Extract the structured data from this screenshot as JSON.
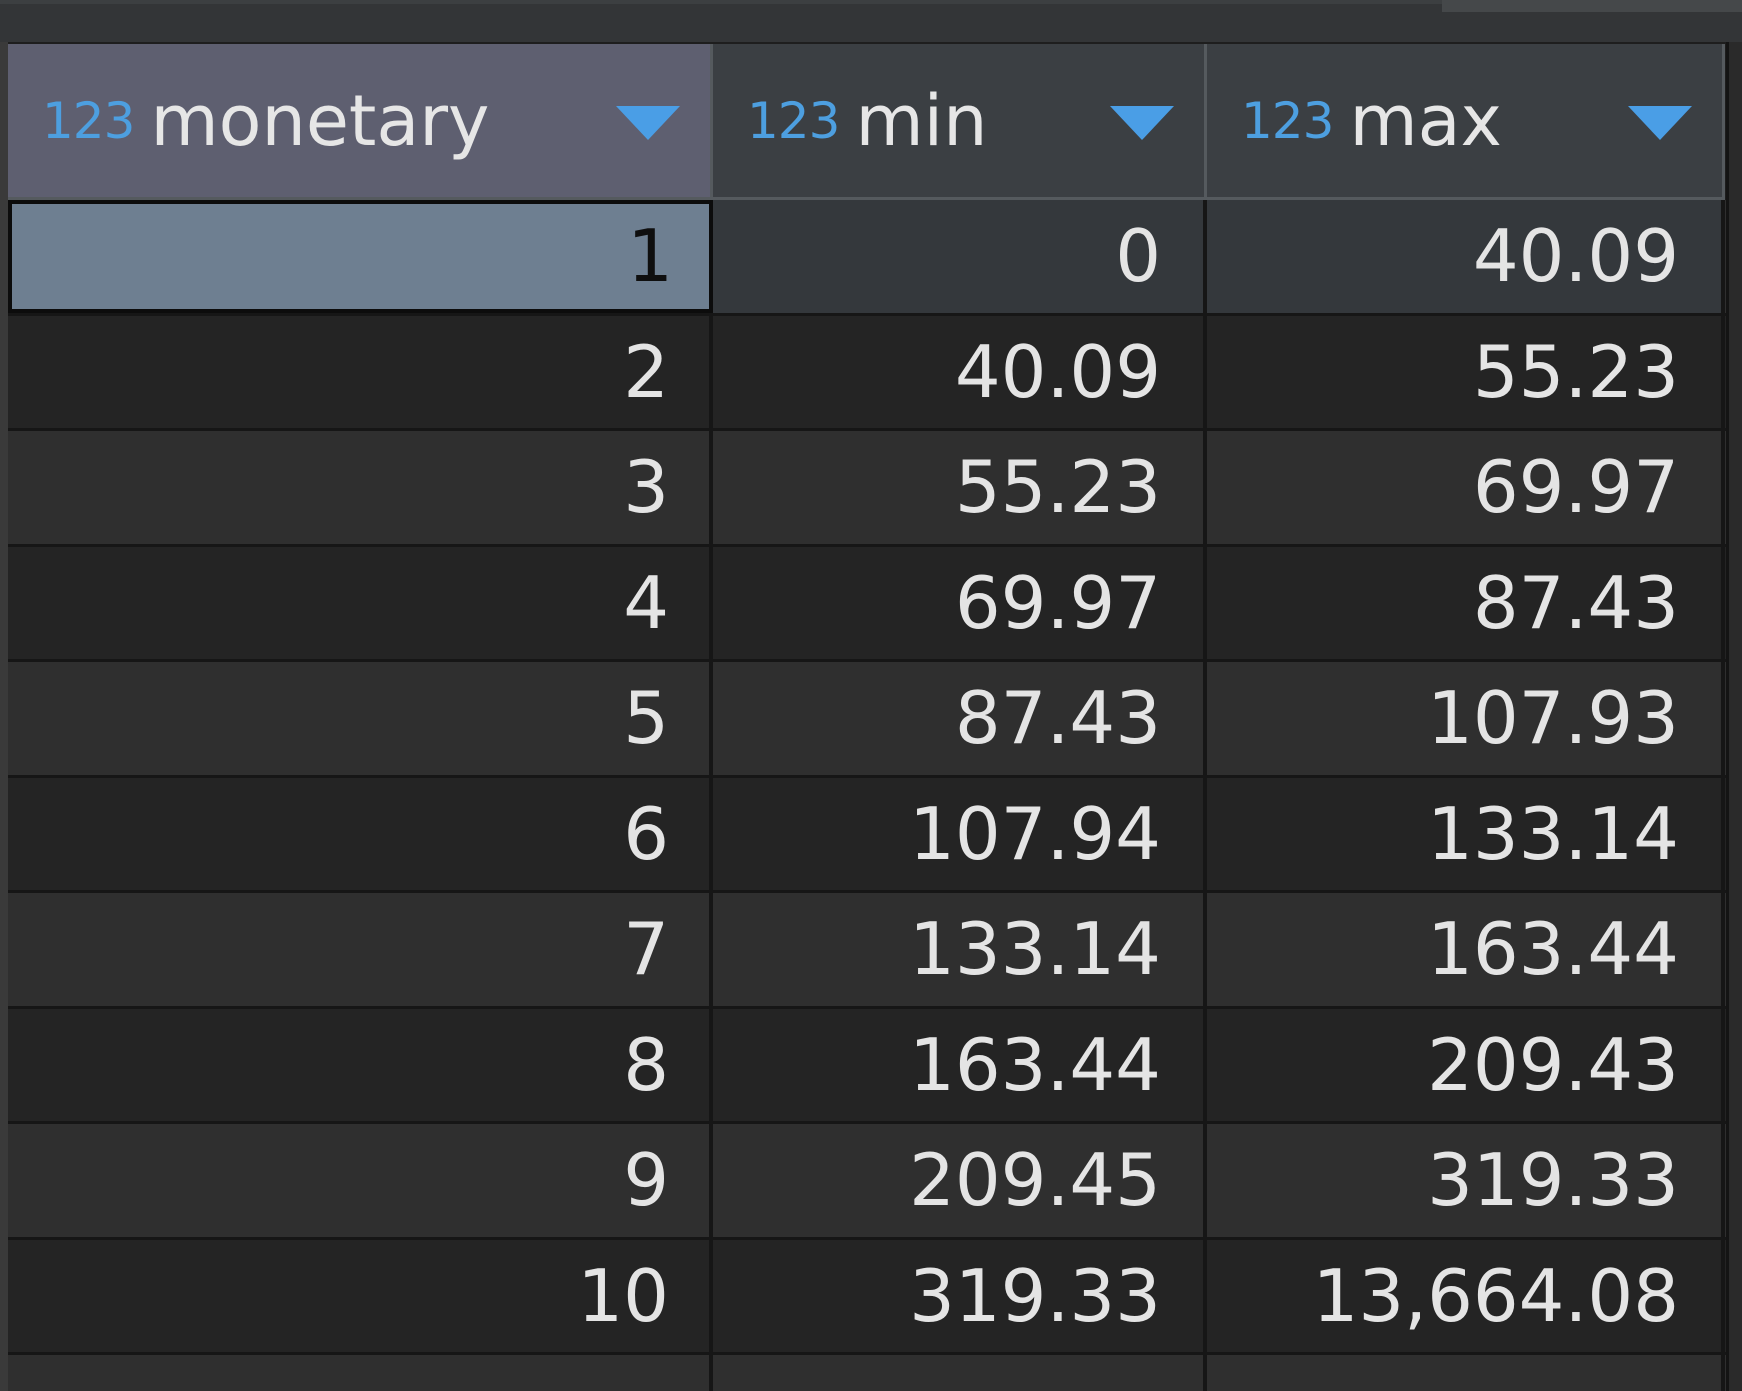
{
  "columns": [
    {
      "type_icon": "123",
      "name": "monetary",
      "sort_icon": "chevron-down-icon"
    },
    {
      "type_icon": "123",
      "name": "min",
      "sort_icon": "chevron-down-icon"
    },
    {
      "type_icon": "123",
      "name": "max",
      "sort_icon": "chevron-down-icon"
    }
  ],
  "rows": [
    [
      "1",
      "0",
      "40.09"
    ],
    [
      "2",
      "40.09",
      "55.23"
    ],
    [
      "3",
      "55.23",
      "69.97"
    ],
    [
      "4",
      "69.97",
      "87.43"
    ],
    [
      "5",
      "87.43",
      "107.93"
    ],
    [
      "6",
      "107.94",
      "133.14"
    ],
    [
      "7",
      "133.14",
      "163.44"
    ],
    [
      "8",
      "163.44",
      "209.43"
    ],
    [
      "9",
      "209.45",
      "319.33"
    ],
    [
      "10",
      "319.33",
      "13,664.08"
    ]
  ],
  "colors": {
    "type_icon": "#4d9fe0",
    "selected_header": "#5e5f70",
    "selected_cell": "#6e7f91"
  }
}
